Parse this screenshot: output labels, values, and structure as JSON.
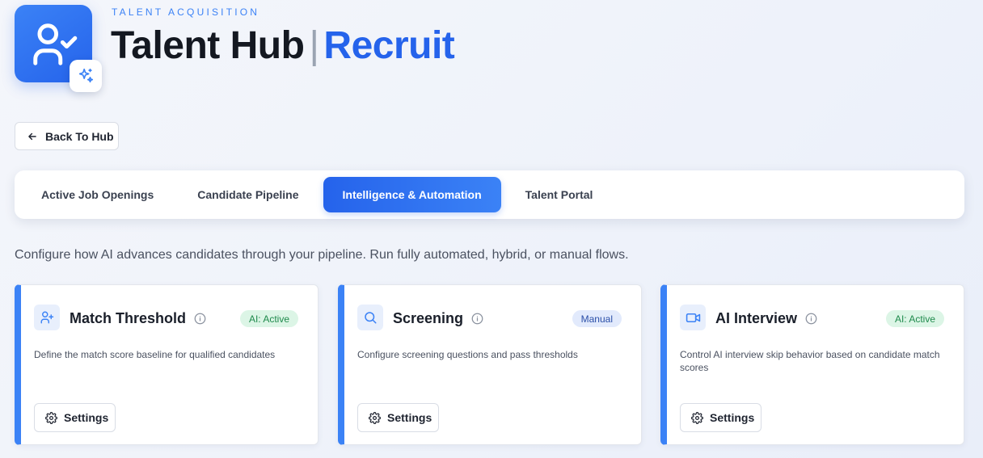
{
  "header": {
    "kicker": "TALENT ACQUISITION",
    "title_main": "Talent Hub",
    "title_separator": "|",
    "title_accent": "Recruit",
    "logo_icon": "user-check-icon",
    "badge_icon": "sparkles-icon"
  },
  "back_button": {
    "label": "Back To Hub",
    "icon": "arrow-left-icon"
  },
  "tabs": [
    {
      "label": "Active Job Openings",
      "active": false
    },
    {
      "label": "Candidate Pipeline",
      "active": false
    },
    {
      "label": "Intelligence & Automation",
      "active": true
    },
    {
      "label": "Talent Portal",
      "active": false
    }
  ],
  "intro": "Configure how AI advances candidates through your pipeline. Run fully automated, hybrid, or manual flows.",
  "cards": [
    {
      "title": "Match Threshold",
      "icon": "user-plus-icon",
      "badge": "AI: Active",
      "description": "Define the match score baseline for qualified candidates",
      "settings_label": "Settings"
    },
    {
      "title": "Screening",
      "icon": "search-icon",
      "badge": "Manual",
      "description": "Configure screening questions and pass thresholds",
      "settings_label": "Settings"
    },
    {
      "title": "AI Interview",
      "icon": "video-icon",
      "badge": "AI: Active",
      "description": "Control AI interview skip behavior based on candidate match scores",
      "settings_label": "Settings"
    }
  ],
  "colors": {
    "accent": "#2563eb",
    "accent_light": "#3b82f6",
    "badge_ai_bg": "#dcf5e6",
    "badge_ai_text": "#1f8a4c",
    "badge_manual_bg": "#e2eafc",
    "badge_manual_text": "#2b4fa8"
  }
}
